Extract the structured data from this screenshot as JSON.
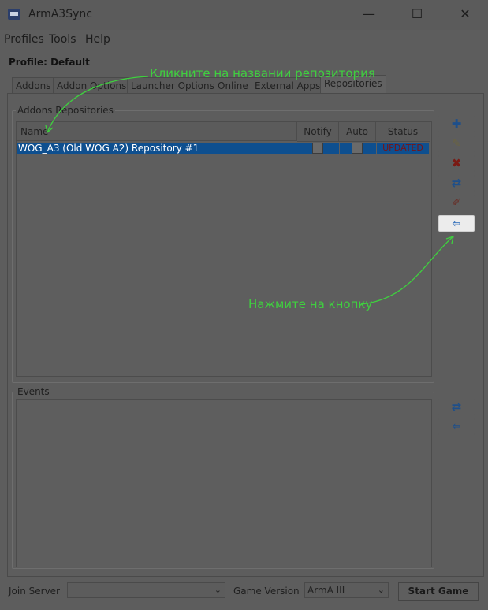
{
  "window": {
    "title": "ArmA3Sync",
    "minimize": "—",
    "maximize": "☐",
    "close": "✕"
  },
  "menu": [
    "Profiles",
    "Tools",
    "Help"
  ],
  "profile_label": "Profile: Default",
  "tabs": [
    "Addons",
    "Addon Options",
    "Launcher Options",
    "Online",
    "External Apps",
    "Repositories"
  ],
  "active_tab": "Repositories",
  "addons_repositories": {
    "group_title": "Addons Repositories",
    "columns": [
      "Name",
      "Notify",
      "Auto",
      "Status"
    ],
    "rows": [
      {
        "name": "WOG_A3 (Old WOG A2) Repository #1",
        "notify": false,
        "auto": false,
        "status": "UPDATED"
      }
    ]
  },
  "side_buttons": {
    "add": "add-icon",
    "edit": "edit-icon",
    "delete": "delete-icon",
    "sync": "sync-icon",
    "tool": "tool-icon",
    "connect": "connect-icon"
  },
  "events": {
    "group_title": "Events"
  },
  "bottom": {
    "join_server_label": "Join Server",
    "join_server_value": "",
    "game_version_label": "Game Version",
    "game_version_value": "ArmA III",
    "start_button": "Start Game"
  },
  "annotations": {
    "click_name": "Кликните на названии репозитория",
    "press_button": "Нажмите на кнопку"
  },
  "colors": {
    "annotation": "#3fd03f",
    "selection": "#0e4f8f",
    "dim_overlay": "#5d5d5d"
  }
}
